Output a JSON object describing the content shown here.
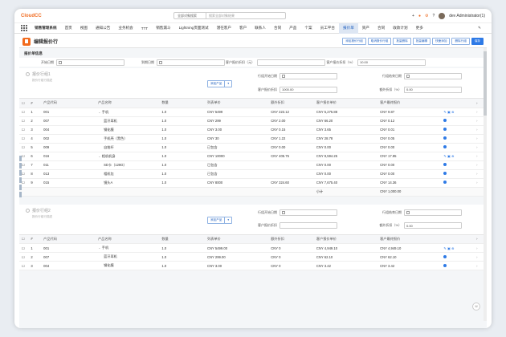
{
  "app": {
    "logo": "CloudCC",
    "title": "销售管理系统"
  },
  "search": {
    "scope": "全部对象搜索",
    "placeholder": "搜索全部对象结果"
  },
  "user": {
    "name": "dev Administrator(1)"
  },
  "nav": [
    "首页",
    "视图",
    "通知公告",
    "业务机会",
    "TTT",
    "销售漏斗",
    "Lightning页面测试",
    "潜在客户",
    "客户",
    "联系人",
    "合同",
    "产品",
    "个案",
    "员工平台",
    "报价单",
    "资产",
    "合同",
    "收款计划",
    "更多"
  ],
  "nav_active_index": 14,
  "page": {
    "title": "编辑报价行"
  },
  "head_buttons": [
    "添加报价行组",
    "取消报价行组",
    "批量删除",
    "批量编辑",
    "快速添加",
    "删除行组",
    "保存"
  ],
  "section": {
    "title": "报价单信息"
  },
  "quote_form": [
    {
      "label": "开始日期",
      "value": ""
    },
    {
      "label": "到期日期",
      "value": ""
    },
    {
      "label": "客户报价折扣（元）",
      "value": ""
    },
    {
      "label": "客户报价折扣（%）",
      "value": "10.00"
    }
  ],
  "groups": [
    {
      "name": "报价行组1",
      "sub": "报价行组行描述",
      "add_label": "添加产品",
      "fields": [
        {
          "label": "行组开始日期",
          "value": ""
        },
        {
          "label": "行组结束日期",
          "value": ""
        },
        {
          "label": "客户报价折扣",
          "value": "1000.00"
        },
        {
          "label": "额外折扣（%）",
          "value": "0.00"
        }
      ],
      "rows": [
        {
          "no": "1",
          "code": "001",
          "name": "手机",
          "tree": true,
          "qty": "1.0",
          "list": "CNY 5499",
          "disc": "CNY 223.12",
          "cust": "CNY 5,275.88",
          "final": "CNY 9.87",
          "tools": true
        },
        {
          "no": "2",
          "code": "007",
          "name": "蓝牙耳机",
          "qty": "1.0",
          "list": "CNY 299",
          "disc": "CNY 2.00",
          "cust": "CNY 66.20",
          "final": "CNY 0.12"
        },
        {
          "no": "3",
          "code": "004",
          "name": "钢化膜",
          "qty": "1.0",
          "list": "CNY 3.00",
          "disc": "CNY 0.15",
          "cust": "CNY 3.65",
          "final": "CNY 0.01"
        },
        {
          "no": "4",
          "code": "002",
          "name": "手机壳（黑色）",
          "qty": "1.0",
          "list": "CNY 30",
          "disc": "CNY 1.22",
          "cust": "CNY 28.78",
          "final": "CNY 0.05"
        },
        {
          "no": "5",
          "code": "009",
          "name": "自拍杆",
          "qty": "1.0",
          "list": "已包含",
          "disc": "CNY 0.00",
          "cust": "CNY 0.00",
          "final": "CNY 0.00"
        },
        {
          "no": "6",
          "code": "016",
          "name": "相机机身",
          "tree": true,
          "qty": "1.0",
          "list": "CNY 10000",
          "disc": "CNY 405.75",
          "cust": "CNY 9,594.25",
          "final": "CNY 17.95",
          "tools": true
        },
        {
          "no": "7",
          "code": "011",
          "name": "SD卡（128G）",
          "qty": "1.0",
          "list": "已包含",
          "disc": "",
          "cust": "CNY 0.00",
          "final": "CNY 0.00"
        },
        {
          "no": "8",
          "code": "013",
          "name": "相机包",
          "qty": "1.0",
          "list": "已包含",
          "disc": "",
          "cust": "CNY 0.00",
          "final": "CNY 0.00"
        },
        {
          "no": "9",
          "code": "015",
          "name": "镜头A",
          "qty": "1.0",
          "list": "CNY 8000",
          "disc": "CNY 324.60",
          "cust": "CNY 7,675.40",
          "final": "CNY 14.36"
        }
      ],
      "subtotal_label": "小计",
      "subtotal": "CNY 1,000.00"
    },
    {
      "name": "报价行组2",
      "sub": "报价行组行描述",
      "add_label": "添加产品",
      "fields": [
        {
          "label": "行组开始日期",
          "value": ""
        },
        {
          "label": "行组结束日期",
          "value": ""
        },
        {
          "label": "客户报价折扣",
          "value": ""
        },
        {
          "label": "额外折扣（%）",
          "value": "0.00"
        }
      ],
      "rows": [
        {
          "no": "1",
          "code": "001",
          "name": "手机",
          "tree": true,
          "qty": "1.0",
          "list": "CNY 5499.00",
          "disc": "CNY 0",
          "cust": "CNY 4,949.10",
          "final": "CNY 4,949.10",
          "tools": true
        },
        {
          "no": "2",
          "code": "007",
          "name": "蓝牙耳机",
          "qty": "1.0",
          "list": "CNY 299.00",
          "disc": "CNY 0",
          "cust": "CNY 62.10",
          "final": "CNY 62.10"
        },
        {
          "no": "3",
          "code": "004",
          "name": "钢化膜",
          "qty": "1.0",
          "list": "CNY 3.00",
          "disc": "CNY 0",
          "cust": "CNY 3.42",
          "final": "CNY 3.42"
        }
      ]
    }
  ],
  "columns": [
    "#",
    "产品代码",
    "产品名称",
    "数量",
    "列表单价",
    "额外折扣",
    "客户报价单价",
    "客户最终报价"
  ]
}
